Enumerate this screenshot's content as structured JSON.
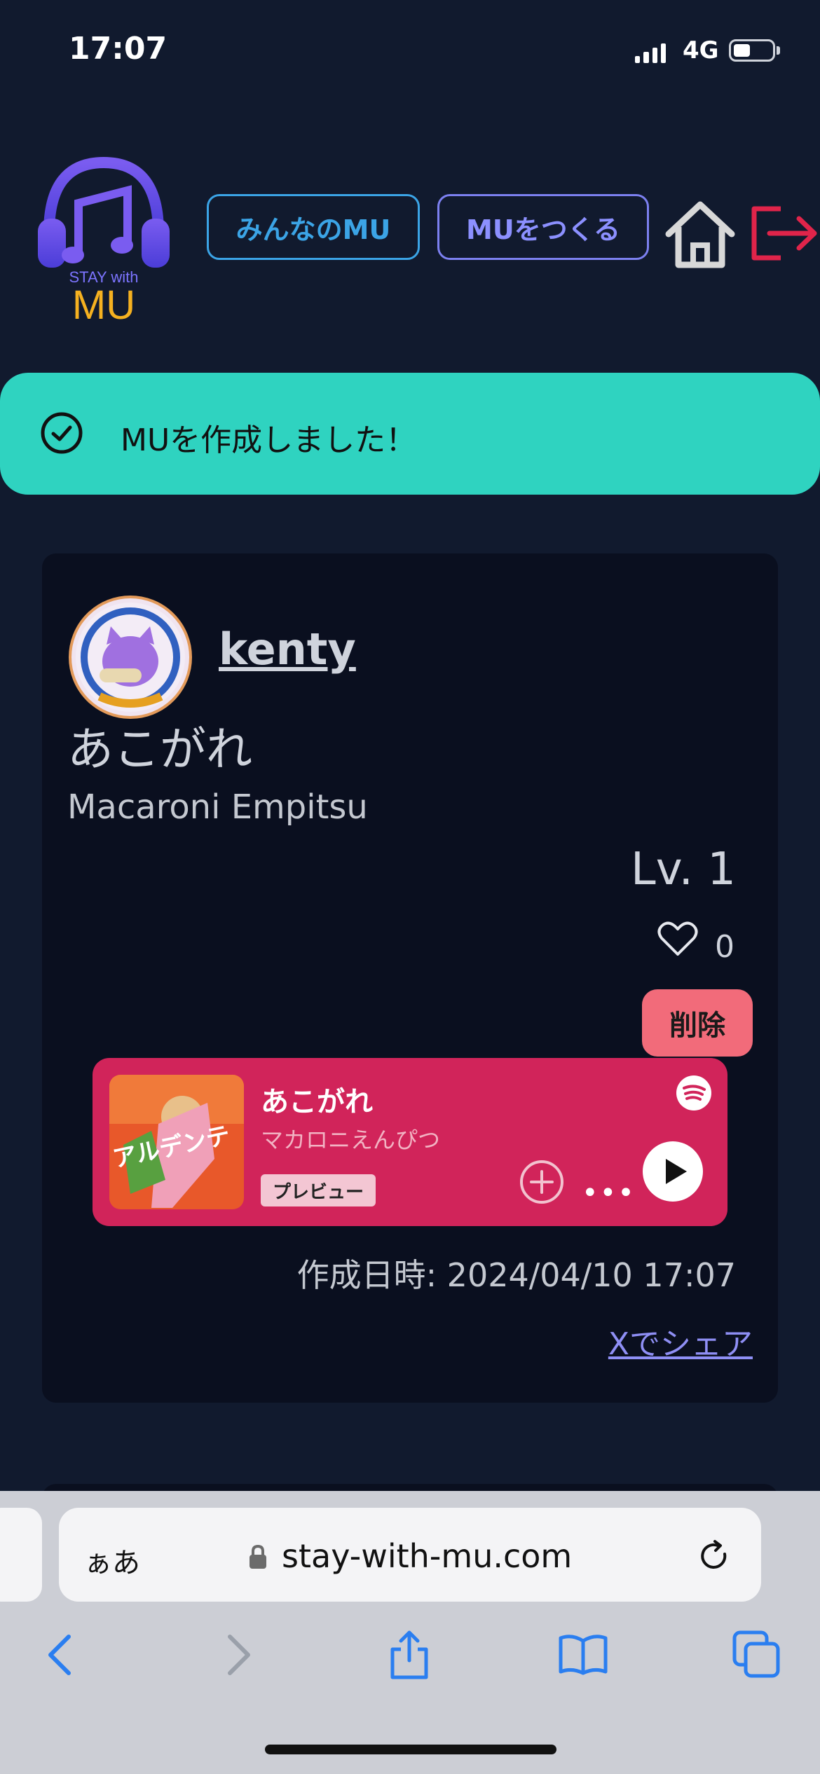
{
  "status_bar": {
    "time": "17:07",
    "network": "4G",
    "battery_level": 0.45
  },
  "header": {
    "logo_tagline": "STAY with",
    "logo_word": "MU",
    "nav_everyone": "みんなのMU",
    "nav_create": "MUをつくる"
  },
  "toast": {
    "message": "MUを作成しました！"
  },
  "card": {
    "username": "kenty",
    "song_title": "あこがれ",
    "artist": "Macaroni Empitsu",
    "level": "Lv. 1",
    "likes": "0",
    "delete_label": "削除",
    "created_at": "作成日時: 2024/04/10 17:07",
    "share_label": "Xでシェア"
  },
  "embed": {
    "title": "あこがれ",
    "artist": "マカロニえんぴつ",
    "preview_label": "プレビュー",
    "more_label": "•••",
    "album_art_text": "アルデンテ"
  },
  "browser": {
    "text_size_label": "ぁあ",
    "url": "stay-with-mu.com"
  },
  "colors": {
    "background": "#111a2e",
    "toast": "#2fd3c0",
    "embed": "#d1245a",
    "delete": "#f26b7a",
    "logo_purple": "#7c74ff",
    "logo_gold": "#f5b120"
  }
}
